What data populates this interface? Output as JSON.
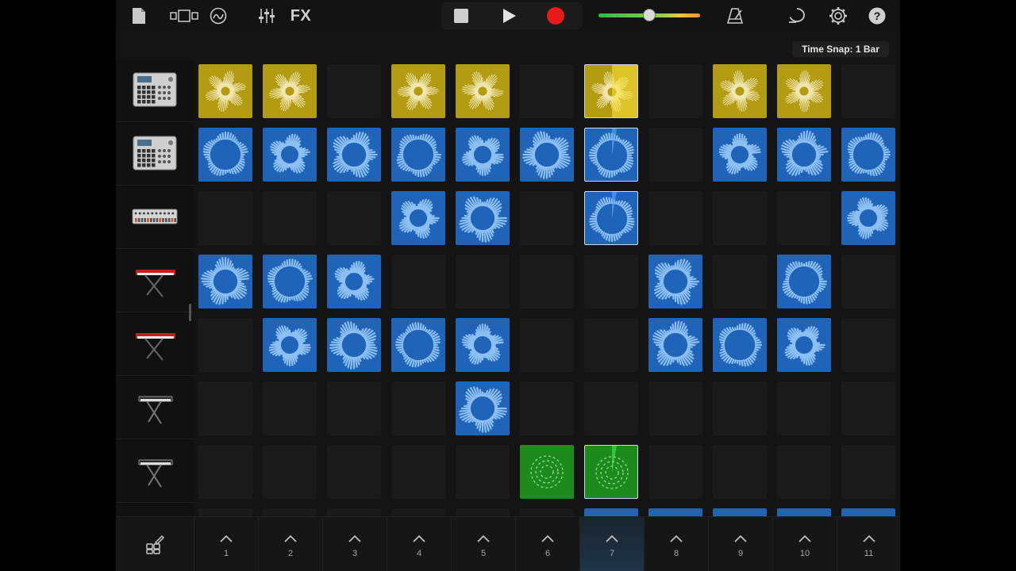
{
  "topbar": {
    "icons": [
      "document-icon",
      "view-toggle-icon",
      "tracks-icon",
      "mixer-icon",
      "fx-label",
      "stop-icon",
      "play-icon",
      "record-icon",
      "volume-slider",
      "metronome-icon",
      "loop-icon",
      "settings-icon",
      "help-icon"
    ],
    "fx_label": "FX",
    "volume": 0.5,
    "record_color": "#e51b1b",
    "slider_colors": [
      "#39b54a",
      "#e89a2a"
    ]
  },
  "time_snap": {
    "label": "Time Snap: 1 Bar"
  },
  "tracks": [
    {
      "name": "drum-machine",
      "icon": "mpc-icon"
    },
    {
      "name": "drum-machine",
      "icon": "mpc-icon"
    },
    {
      "name": "beat-sequencer",
      "icon": "tr-drum-icon"
    },
    {
      "name": "red-keyboard",
      "icon": "red-keyboard-icon"
    },
    {
      "name": "red-keyboard",
      "icon": "red-keyboard-icon"
    },
    {
      "name": "keyboard",
      "icon": "keyboard-icon"
    },
    {
      "name": "keyboard",
      "icon": "keyboard-icon"
    }
  ],
  "grid": {
    "columns": 11,
    "colors": {
      "yellow": "#b39b12",
      "blue": "#1f64b8",
      "green": "#1c8a1c"
    },
    "rows": [
      [
        "yellow",
        "yellow",
        "empty",
        "yellow",
        "yellow",
        "empty",
        "yellow-playing",
        "empty",
        "yellow",
        "yellow",
        "empty"
      ],
      [
        "blue",
        "blue",
        "blue",
        "blue",
        "blue",
        "blue",
        "blue-playing",
        "empty",
        "blue",
        "blue",
        "blue"
      ],
      [
        "empty",
        "empty",
        "empty",
        "blue",
        "blue",
        "empty",
        "blue-playing",
        "empty",
        "empty",
        "empty",
        "blue"
      ],
      [
        "blue",
        "blue",
        "blue",
        "empty",
        "empty",
        "empty",
        "empty",
        "blue",
        "empty",
        "blue",
        "empty"
      ],
      [
        "empty",
        "blue",
        "blue",
        "blue",
        "blue",
        "empty",
        "empty",
        "blue",
        "blue",
        "blue",
        "empty"
      ],
      [
        "empty",
        "empty",
        "empty",
        "empty",
        "blue",
        "empty",
        "empty",
        "empty",
        "empty",
        "empty",
        "empty"
      ],
      [
        "empty",
        "empty",
        "empty",
        "empty",
        "empty",
        "green",
        "green-playing",
        "empty",
        "empty",
        "empty",
        "empty"
      ]
    ]
  },
  "bottombar": {
    "edit_icon": "edit-cells-icon",
    "columns": [
      {
        "num": "1"
      },
      {
        "num": "2"
      },
      {
        "num": "3"
      },
      {
        "num": "4"
      },
      {
        "num": "5"
      },
      {
        "num": "6"
      },
      {
        "num": "7",
        "active": true
      },
      {
        "num": "8"
      },
      {
        "num": "9"
      },
      {
        "num": "10"
      },
      {
        "num": "11"
      }
    ]
  }
}
